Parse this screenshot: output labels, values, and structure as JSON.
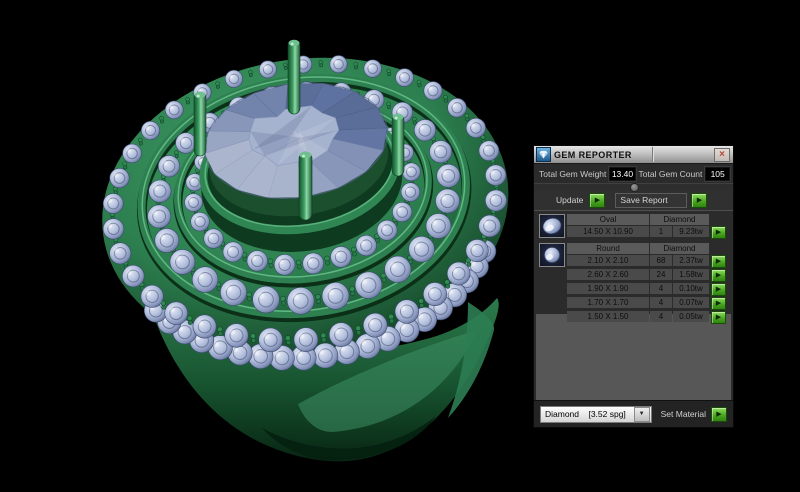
{
  "scene": {
    "colors": {
      "background": "#000000",
      "metal_green": "#2f7d4c",
      "metal_green_dark": "#0a2c17",
      "gem_blue": "#a9b6d6",
      "gem_blue_light": "#d9e1f2"
    }
  },
  "panel": {
    "title": "GEM REPORTER",
    "close_glyph": "×",
    "totals": {
      "weight_label": "Total Gem Weight",
      "weight_value": "13.40",
      "count_label": "Total Gem Count",
      "count_value": "105"
    },
    "actions": {
      "update_label": "Update",
      "save_report_label": "Save Report",
      "run_glyph": "▶"
    },
    "table": {
      "groups": [
        {
          "thumb": "oval-gem-thumb",
          "shape": "Oval",
          "material": "Diamond",
          "rows": [
            {
              "size": "14.50 X 10.90",
              "count": "1",
              "weight": "9.23tw"
            }
          ]
        },
        {
          "thumb": "round-gem-thumb",
          "shape": "Round",
          "material": "Diamond",
          "rows": [
            {
              "size": "2.10 X 2.10",
              "count": "68",
              "weight": "2.37tw"
            },
            {
              "size": "2.60 X 2.60",
              "count": "24",
              "weight": "1.58tw"
            },
            {
              "size": "1.90 X 1.90",
              "count": "4",
              "weight": "0.10tw"
            },
            {
              "size": "1.70 X 1.70",
              "count": "4",
              "weight": "0.07tw"
            },
            {
              "size": "1.50 X 1.50",
              "count": "4",
              "weight": "0.05tw"
            }
          ]
        }
      ]
    },
    "material_bar": {
      "dropdown_value": "Diamond    [3.52 spg]",
      "dropdown_arrow_glyph": "▼",
      "set_material_label": "Set Material"
    },
    "colors": {
      "accent_green_button": "#46a31e",
      "panel_bg": "#2b2b2b",
      "body_bg": "#575757",
      "close_x": "#b5473f"
    }
  }
}
